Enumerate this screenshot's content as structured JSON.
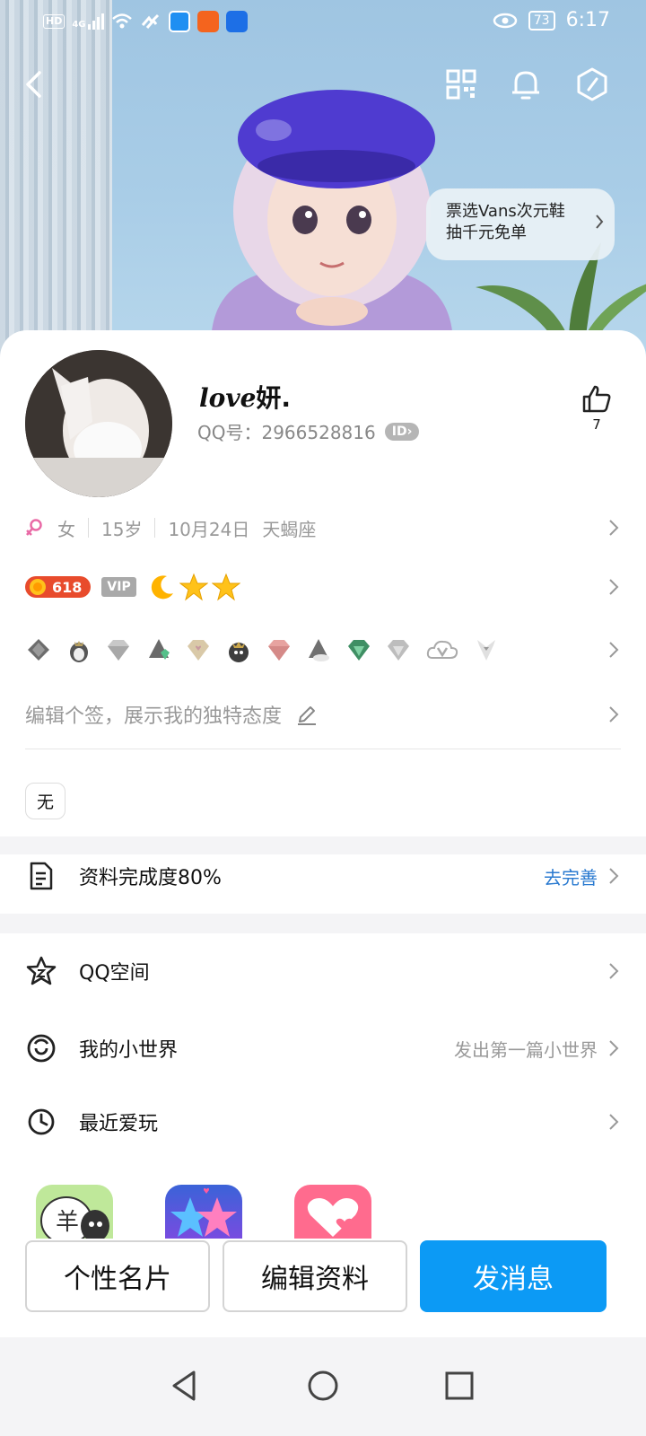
{
  "status_bar": {
    "hd": "HD",
    "network": "4G",
    "battery": "73",
    "time": "6:17"
  },
  "promo": {
    "line1": "票选Vans次元鞋",
    "line2": "抽千元免单"
  },
  "profile": {
    "nick_love": "love",
    "nick_rest": "妍.",
    "qq_label": "QQ号：2966528816",
    "id_badge": "ID",
    "likes": "7",
    "gender": "女",
    "age": "15岁",
    "birthday": "10月24日",
    "zodiac": "天蝎座",
    "level": "618",
    "vip": "VIP",
    "signature_placeholder": "编辑个签，展示我的独特态度",
    "tag": "无"
  },
  "menu": {
    "completion": {
      "label": "资料完成度80%",
      "action": "去完善"
    },
    "qzone": {
      "label": "QQ空间"
    },
    "small_world": {
      "label": "我的小世界",
      "hint": "发出第一篇小世界"
    },
    "recent": {
      "label": "最近爱玩"
    }
  },
  "actions": {
    "card": "个性名片",
    "edit": "编辑资料",
    "message": "发消息"
  },
  "colors": {
    "primary": "#0c9af5",
    "link": "#2a7ad0"
  }
}
